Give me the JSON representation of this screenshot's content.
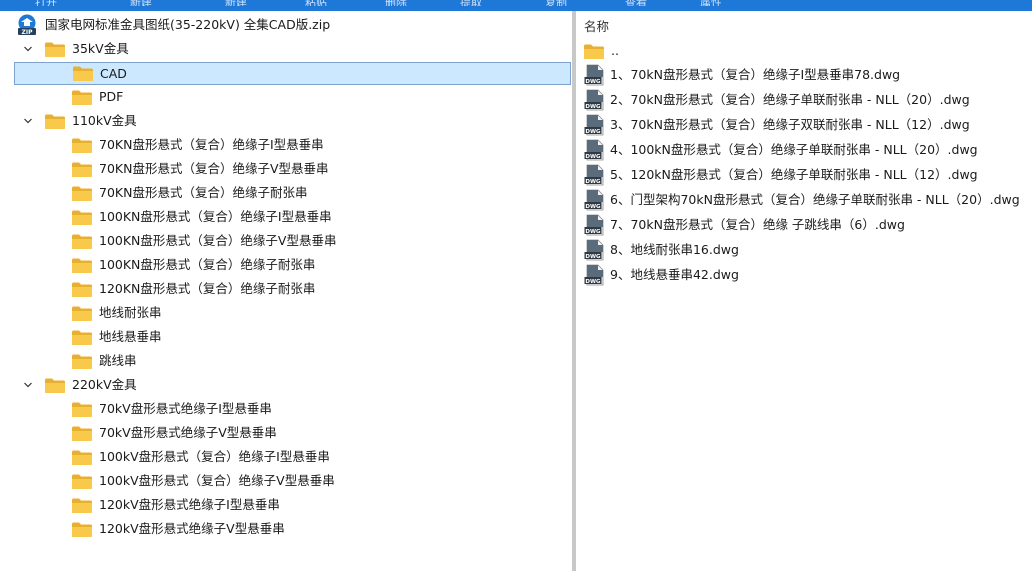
{
  "topbar": {
    "items": [
      "打开",
      "新建",
      "新建",
      "粘贴",
      "删除",
      "提取",
      "复制",
      "查看",
      "属性"
    ]
  },
  "tree": {
    "root_label": "国家电网标准金具图纸(35-220kV) 全集CAD版.zip",
    "nodes": [
      {
        "label": "35kV金具",
        "level": 1,
        "expanded": true
      },
      {
        "label": "CAD",
        "level": 2,
        "selected": true
      },
      {
        "label": "PDF",
        "level": 2
      },
      {
        "label": "110kV金具",
        "level": 1,
        "expanded": true
      },
      {
        "label": "70KN盘形悬式（复合）绝缘子Ⅰ型悬垂串",
        "level": 2
      },
      {
        "label": "70KN盘形悬式（复合）绝缘子V型悬垂串",
        "level": 2
      },
      {
        "label": "70KN盘形悬式（复合）绝缘子耐张串",
        "level": 2
      },
      {
        "label": "100KN盘形悬式（复合）绝缘子Ⅰ型悬垂串",
        "level": 2
      },
      {
        "label": "100KN盘形悬式（复合）绝缘子V型悬垂串",
        "level": 2
      },
      {
        "label": "100KN盘形悬式（复合）绝缘子耐张串",
        "level": 2
      },
      {
        "label": "120KN盘形悬式（复合）绝缘子耐张串",
        "level": 2
      },
      {
        "label": "地线耐张串",
        "level": 2
      },
      {
        "label": "地线悬垂串",
        "level": 2
      },
      {
        "label": "跳线串",
        "level": 2
      },
      {
        "label": "220kV金具",
        "level": 1,
        "expanded": true
      },
      {
        "label": "70kV盘形悬式绝缘子Ⅰ型悬垂串",
        "level": 2
      },
      {
        "label": "70kV盘形悬式绝缘子Ⅴ型悬垂串",
        "level": 2
      },
      {
        "label": "100kV盘形悬式（复合）绝缘子Ⅰ型悬垂串",
        "level": 2
      },
      {
        "label": "100kV盘形悬式（复合）绝缘子Ⅴ型悬垂串",
        "level": 2
      },
      {
        "label": "120kV盘形悬式绝缘子Ⅰ型悬垂串",
        "level": 2
      },
      {
        "label": "120kV盘形悬式绝缘子V型悬垂串",
        "level": 2
      }
    ]
  },
  "files": {
    "column_header": "名称",
    "parent_label": "..",
    "items": [
      "1、70kN盘形悬式（复合）绝缘子I型悬垂串78.dwg",
      "2、70kN盘形悬式（复合）绝缘子单联耐张串 - NLL（20）.dwg",
      "3、70kN盘形悬式（复合）绝缘子双联耐张串 - NLL（12）.dwg",
      "4、100kN盘形悬式（复合）绝缘子单联耐张串 - NLL（20）.dwg",
      "5、120kN盘形悬式（复合）绝缘子单联耐张串 - NLL（12）.dwg",
      "6、门型架构70kN盘形悬式（复合）绝缘子单联耐张串 - NLL（20）.dwg",
      "7、70kN盘形悬式（复合）绝缘 子跳线串（6）.dwg",
      "8、地线耐张串16.dwg",
      "9、地线悬垂串42.dwg"
    ],
    "icon_badge": "DWG"
  },
  "colors": {
    "accent": "#1e78d8",
    "selection_bg": "#cce8ff",
    "selection_border": "#7da2ce",
    "folder": "#f8c94a"
  }
}
